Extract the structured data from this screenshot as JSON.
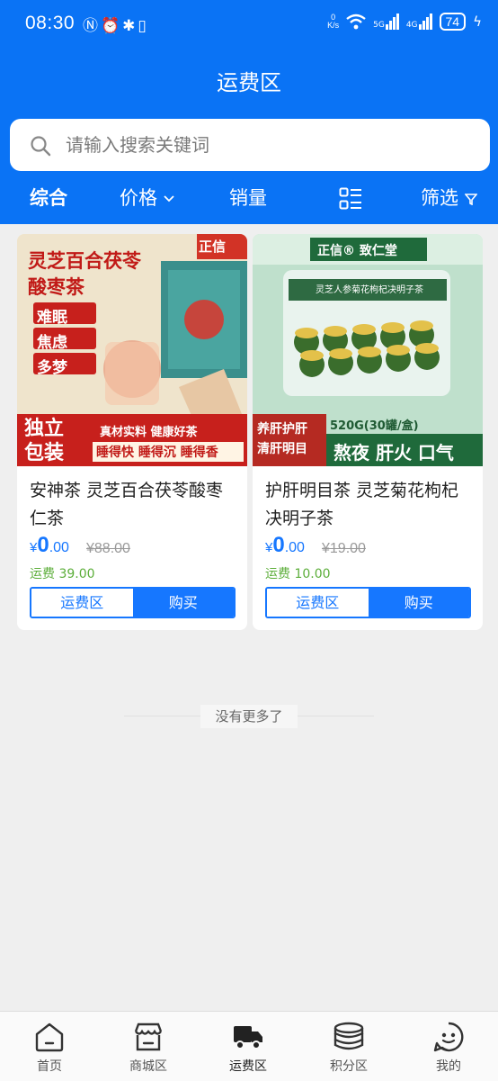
{
  "status_bar": {
    "time": "08:30",
    "left_icons": [
      "n-icon",
      "alarm-icon",
      "bluetooth-icon",
      "vibrate-icon"
    ],
    "net_speed_value": "0",
    "net_speed_unit": "K/s",
    "signal_1": "5G",
    "signal_2": "4G",
    "battery": "74"
  },
  "header": {
    "title": "运费区",
    "background_color": "#0a73f5"
  },
  "search": {
    "placeholder": "请输入搜索关键词",
    "value": ""
  },
  "sort_bar": {
    "comprehensive": "综合",
    "price": "价格",
    "sales": "销量",
    "filter": "筛选"
  },
  "products": [
    {
      "name": "安神茶 灵芝百合茯苓酸枣仁茶",
      "price_symbol": "¥",
      "price_int": "0",
      "price_dec": ".00",
      "original_price": "¥88.00",
      "shipping_fee": "运费 39.00",
      "zone_button": "运费区",
      "buy_button": "购买",
      "image": {
        "badge": "正信",
        "headline_1": "灵芝百合茯苓",
        "headline_2": "酸枣茶",
        "tags": [
          "难眠",
          "焦虑",
          "多梦"
        ],
        "corner": "独立包装",
        "corner_1": "独立",
        "corner_2": "包装",
        "slogan_1": "真材实料 健康好茶",
        "slogan_2": "睡得快 睡得沉 睡得香"
      }
    },
    {
      "name": "护肝明目茶 灵芝菊花枸杞决明子茶",
      "price_symbol": "¥",
      "price_int": "0",
      "price_dec": ".00",
      "original_price": "¥19.00",
      "shipping_fee": "运费 10.00",
      "zone_button": "运费区",
      "buy_button": "购买",
      "image": {
        "badge": "正信® 致仁堂",
        "box_label": "灵芝人参菊花枸杞决明子茶",
        "spec": "520G(30罐/盒)",
        "corner_1": "养肝护肝",
        "corner_2": "清肝明目",
        "slogan": "熬夜 肝火 口气"
      }
    }
  ],
  "no_more": "没有更多了",
  "tab_bar": {
    "items": [
      {
        "label": "首页",
        "icon": "home-icon"
      },
      {
        "label": "商城区",
        "icon": "shop-icon"
      },
      {
        "label": "运费区",
        "icon": "truck-icon",
        "active": true
      },
      {
        "label": "积分区",
        "icon": "coins-icon"
      },
      {
        "label": "我的",
        "icon": "profile-icon"
      }
    ]
  }
}
